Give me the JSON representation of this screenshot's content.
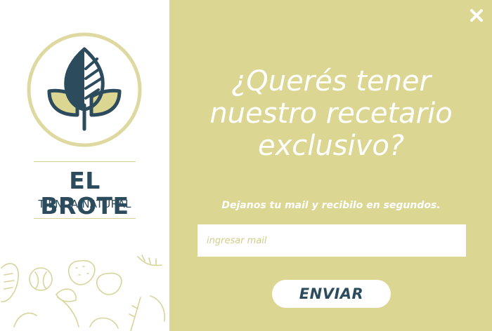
{
  "brand": {
    "name": "EL BROTE",
    "tagline": "TIENDA NATURAL",
    "logo_icon": "leaf-sprout-icon"
  },
  "popup": {
    "headline": "¿Querés tener nuestro recetario exclusivo?",
    "subtitle": "Dejanos tu mail y recibilo en segundos.",
    "email_placeholder": "ingresar mail",
    "email_value": "",
    "submit_label": "ENVIAR",
    "close_icon": "close-icon"
  },
  "colors": {
    "panel_background": "#dcd693",
    "brand_navy": "#2c4b5d",
    "brand_olive": "#d5d095",
    "white": "#ffffff"
  }
}
